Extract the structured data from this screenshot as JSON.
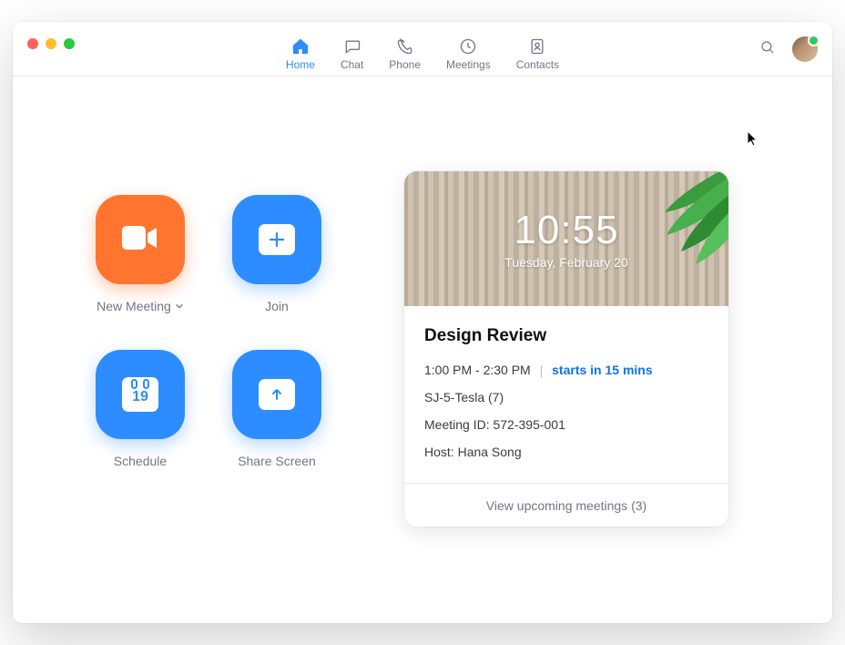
{
  "nav": {
    "tabs": [
      {
        "label": "Home",
        "active": true
      },
      {
        "label": "Chat"
      },
      {
        "label": "Phone"
      },
      {
        "label": "Meetings"
      },
      {
        "label": "Contacts"
      }
    ]
  },
  "actions": {
    "new_meeting": "New Meeting",
    "join": "Join",
    "schedule": "Schedule",
    "schedule_day": "19",
    "share_screen": "Share Screen"
  },
  "clock": {
    "time": "10:55",
    "date": "Tuesday, February 20"
  },
  "meeting": {
    "title": "Design Review",
    "time_range": "1:00 PM - 2:30 PM",
    "starts_in": "starts in 15 mins",
    "room": "SJ-5-Tesla (7)",
    "meeting_id_label": "Meeting ID:",
    "meeting_id": "572-395-001",
    "host_label": "Host:",
    "host": "Hana Song"
  },
  "footer": {
    "upcoming": "View upcoming meetings (3)"
  }
}
